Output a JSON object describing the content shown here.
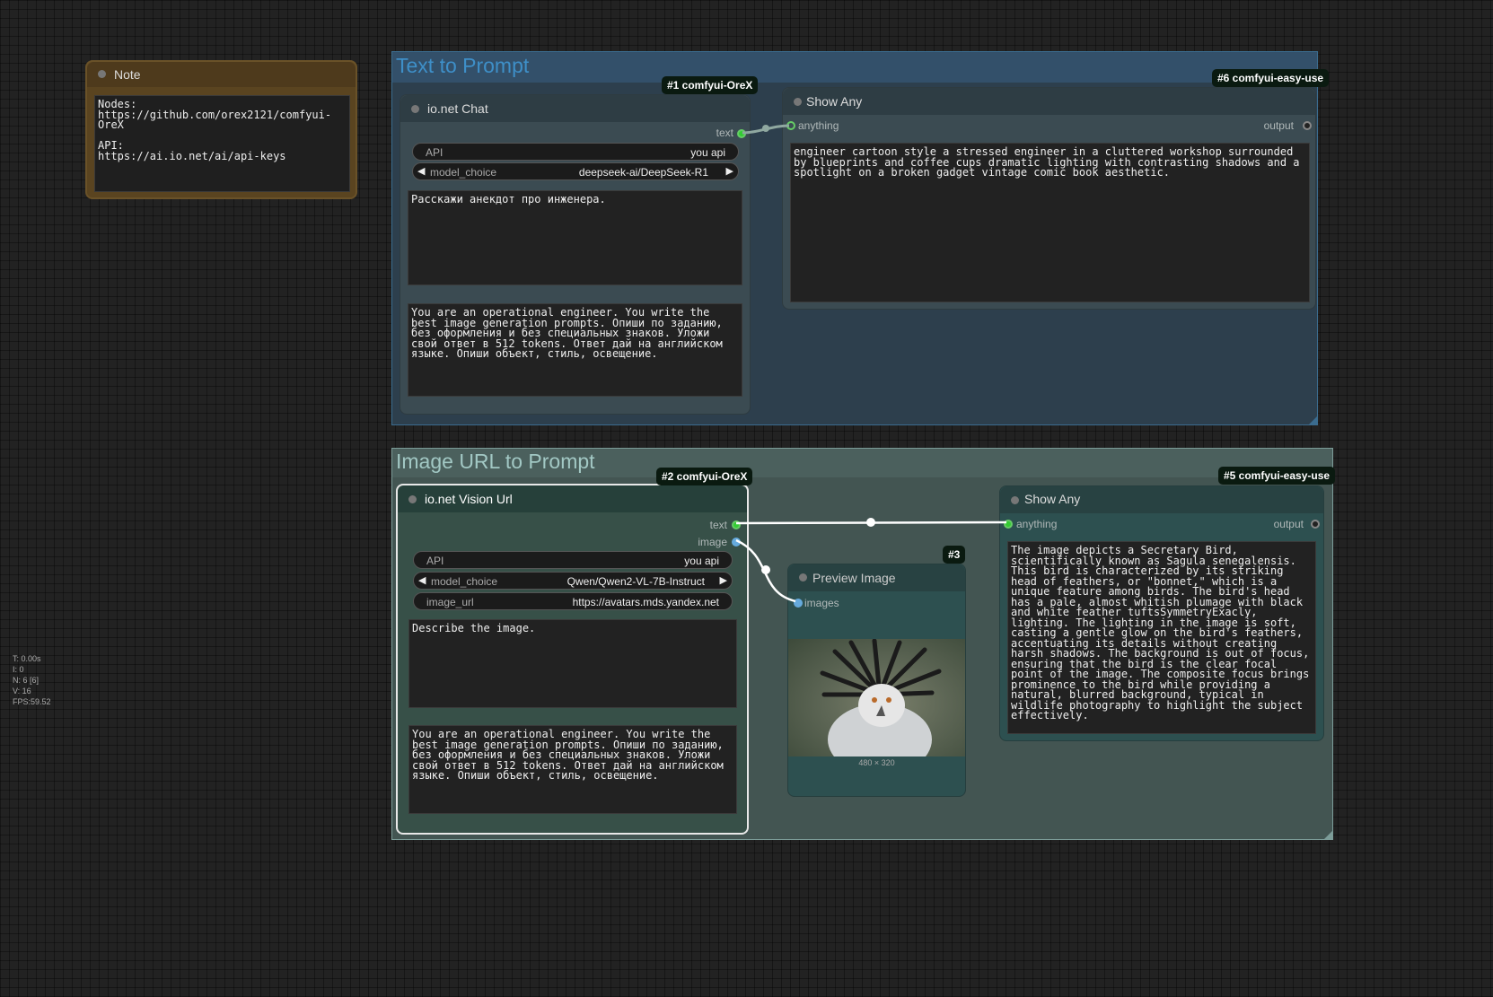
{
  "note": {
    "title": "Note",
    "text": "Nodes:\nhttps://github.com/orex2121/comfyui-OreX\n\nAPI:\nhttps://ai.io.net/ai/api-keys"
  },
  "group1": {
    "title": "Text to Prompt",
    "chat_node": {
      "badge": "#1 comfyui-OreX",
      "title": "io.net Chat",
      "output_label": "text",
      "api_label": "API",
      "api_value": "you api",
      "model_label": "model_choice",
      "model_value": "deepseek-ai/DeepSeek-R1",
      "prompt": "Расскажи анекдот про инженера.",
      "system_prompt": "You are an operational engineer. You write the best image generation prompts. Опиши по заданию, без оформления и без специальных знаков. Уложи свой ответ в 512 tokens. Ответ дай на английском языке. Опиши объект, стиль, освещение."
    },
    "show_node": {
      "badge": "#6 comfyui-easy-use",
      "title": "Show Any",
      "input_label": "anything",
      "output_label": "output",
      "text": "engineer cartoon style a stressed engineer in a cluttered workshop surrounded by blueprints and coffee cups dramatic lighting with contrasting shadows and a spotlight on a broken gadget vintage comic book aesthetic."
    }
  },
  "group2": {
    "title": "Image URL to Prompt",
    "vision_node": {
      "badge": "#2 comfyui-OreX",
      "title": "io.net Vision Url",
      "output_text": "text",
      "output_image": "image",
      "api_label": "API",
      "api_value": "you api",
      "model_label": "model_choice",
      "model_value": "Qwen/Qwen2-VL-7B-Instruct",
      "url_label": "image_url",
      "url_value": "https://avatars.mds.yandex.net",
      "prompt": "Describe the image.",
      "system_prompt": "You are an operational engineer. You write the best image generation prompts. Опиши по заданию, без оформления и без специальных знаков. Уложи свой ответ в 512 tokens. Ответ дай на английском языке. Опиши объект, стиль, освещение."
    },
    "preview_node": {
      "badge": "#3",
      "title": "Preview Image",
      "input_label": "images",
      "image_size": "480 × 320"
    },
    "show_node": {
      "badge": "#5 comfyui-easy-use",
      "title": "Show Any",
      "input_label": "anything",
      "output_label": "output",
      "text": "The image depicts a Secretary Bird, scientifically known as Sagula senegalensis. This bird is characterized by its striking head of feathers, or \"bonnet,\" which is a unique feature among birds. The bird's head has a pale, almost whitish plumage with black and white feather tuftsSymmetryExacly, lighting. The lighting in the image is soft, casting a gentle glow on the bird's feathers, accentuating its details without creating harsh shadows. The background is out of focus, ensuring that the bird is the clear focal point of the image. The composite focus brings prominence to the bird while providing a natural, blurred background, typical in wildlife photography to highlight the subject effectively."
    }
  },
  "stats": {
    "t": "T: 0.00s",
    "i": "I: 0",
    "n": "N: 6 [6]",
    "v": "V: 16",
    "fps": "FPS:59.52"
  },
  "colors": {
    "group1_bg": "#2d3f4d",
    "group1_border": "#3b6c8f",
    "group2_bg": "#435552",
    "group2_border": "#7c9c98",
    "note_bg": "#5a4420",
    "node_bg": "#3b4b52"
  }
}
